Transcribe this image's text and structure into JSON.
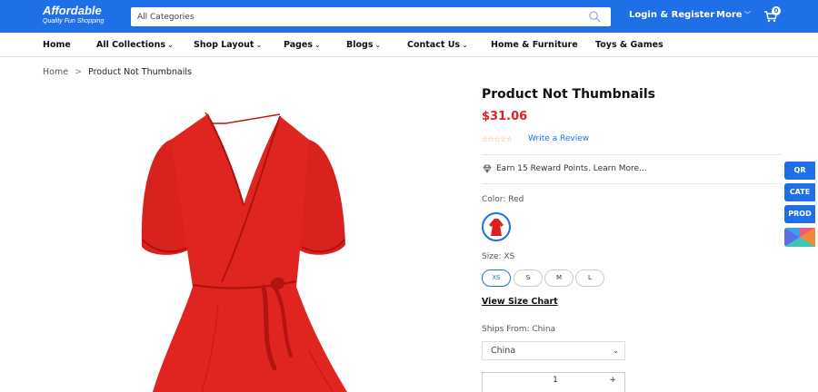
{
  "header": {
    "logo_name": "Affordable",
    "logo_tagline": "Quality Fun Shopping",
    "search_placeholder": "All Categories",
    "login_label": "Login & Register",
    "more_label": "More",
    "cart_count": "0",
    "brand_color": "#1f6fe6"
  },
  "nav": {
    "items": [
      {
        "label": "Home",
        "has_dropdown": false
      },
      {
        "label": "All Collections",
        "has_dropdown": true
      },
      {
        "label": "Shop Layout",
        "has_dropdown": true
      },
      {
        "label": "Pages",
        "has_dropdown": true
      },
      {
        "label": "Blogs",
        "has_dropdown": true
      },
      {
        "label": "Contact Us",
        "has_dropdown": true
      },
      {
        "label": "Home & Furniture",
        "has_dropdown": false
      },
      {
        "label": "Toys & Games",
        "has_dropdown": false
      }
    ]
  },
  "breadcrumb": {
    "home": "Home",
    "separator": ">",
    "current": "Product Not Thumbnails"
  },
  "product": {
    "title": "Product Not Thumbnails",
    "price": "$31.06",
    "price_color": "#d8232a",
    "rating_stars": "☆☆☆☆☆",
    "write_review": "Write a Review",
    "reward_text": "Earn 15 Reward Points.  Learn More...",
    "color_label": "Color: Red",
    "size_label": "Size: XS",
    "sizes": [
      "XS",
      "S",
      "M",
      "L"
    ],
    "selected_size": "XS",
    "size_chart_label": "View Size Chart",
    "ships_from_label": "Ships From: China",
    "ships_from_value": "China",
    "quantity": "1",
    "quantity_plus": "+"
  },
  "side_buttons": [
    "QR",
    "CATE",
    "PROD"
  ]
}
